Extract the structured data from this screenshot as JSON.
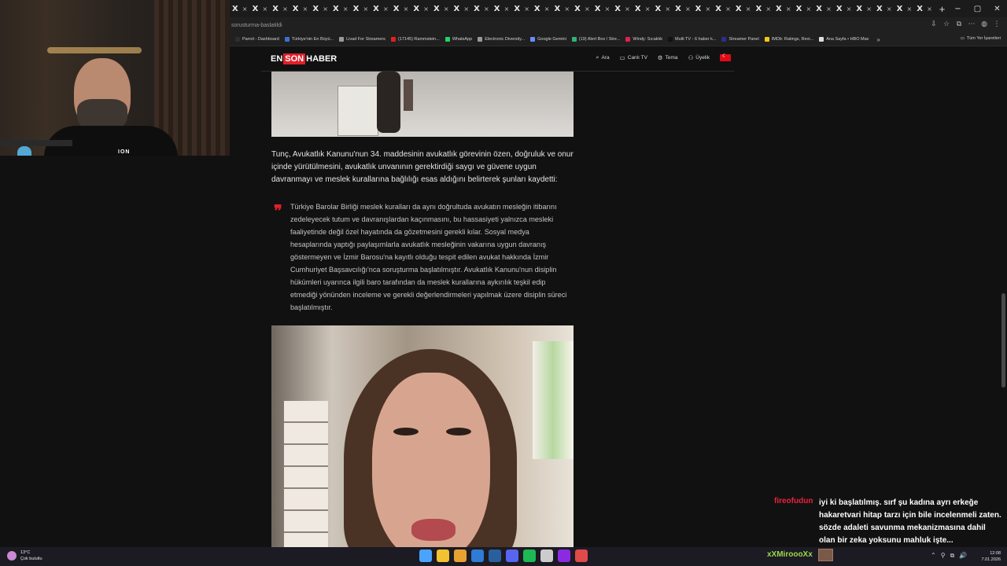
{
  "browser": {
    "tab_count": 35,
    "tab_logo": "X",
    "tab_close": "×",
    "new_tab": "+",
    "url": "sorusturma-baslatildi",
    "window_controls": [
      "−",
      "▢",
      "✕"
    ],
    "address_icons": [
      "⇩",
      "☆",
      "⧉",
      "⋯",
      "◍",
      "⋮"
    ]
  },
  "bookmarks": {
    "items": [
      {
        "label": "Parrot - Dashboard",
        "color": "#2e2e2e"
      },
      {
        "label": "Türkiye'nin En Büyü...",
        "color": "#3d6fd1"
      },
      {
        "label": "Livad For Streamers",
        "color": "#9a9a9a"
      },
      {
        "label": "(17145) Rammstein...",
        "color": "#e02020"
      },
      {
        "label": "WhatsApp",
        "color": "#25d366"
      },
      {
        "label": "Electronic Diversity...",
        "color": "#9a9a9a"
      },
      {
        "label": "Google Gemini",
        "color": "#6a8cff"
      },
      {
        "label": "(19) Alert Box / Stre...",
        "color": "#2bb673"
      },
      {
        "label": "Windy: Sıcaklık",
        "color": "#e02050"
      },
      {
        "label": "Multi TV - 6 haber k...",
        "color": "#111111"
      },
      {
        "label": "Streamer Panel",
        "color": "#2d2d8a"
      },
      {
        "label": "IMDb: Ratings, Revi...",
        "color": "#f5c518"
      },
      {
        "label": "Ana Sayfa • HBO Max",
        "color": "#dddddd"
      }
    ],
    "more": "»",
    "all_bookmarks": "Tüm Yer İşaretleri"
  },
  "webcam": {
    "shirt_logo": "ION"
  },
  "site": {
    "logo_en": "EN",
    "logo_son": "SON",
    "logo_haber": "HABER",
    "nav": [
      {
        "icon": "⌕",
        "label": "Ara"
      },
      {
        "icon": "▭",
        "label": "Canlı TV"
      },
      {
        "icon": "⚙",
        "label": "Tema"
      },
      {
        "icon": "⚇",
        "label": "Üyelik"
      }
    ]
  },
  "article": {
    "paragraph": "Tunç, Avukatlık Kanunu'nun 34. maddesinin avukatlık görevinin özen, doğruluk ve onur içinde yürütülmesini, avukatlık unvanının gerektirdiği saygı ve güvene uygun davranmayı ve meslek kurallarına bağlılığı esas aldığını belirterek şunları kaydetti:",
    "quote_mark": "❞",
    "quote": "Türkiye Barolar Birliği meslek kuralları da aynı doğrultuda avukatın mesleğin itibarını zedeleyecek tutum ve davranışlardan kaçınmasını, bu hassasiyeti yalnızca mesleki faaliyetinde değil özel hayatında da gözetmesini gerekli kılar. Sosyal medya hesaplarında yaptığı paylaşımlarla avukatlık mesleğinin vakarına uygun davranış göstermeyen ve İzmir Barosu'na kayıtlı olduğu tespit edilen avukat hakkında İzmir Cumhuriyet Başsavcılığı'nca soruşturma başlatılmıştır. Avukatlık Kanunu'nun disiplin hükümleri uyarınca ilgili baro tarafından da meslek kurallarına aykırılık teşkil edip etmediği yönünden inceleme ve gerekli değerlendirmeleri yapılmak üzere disiplin süreci başlatılmıştır."
  },
  "chat": {
    "username": "fireofudun",
    "message": "iyi ki başlatılmış. sırf şu kadına ayrı erkeğe hakaretvari hitap tarzı için bile incelenmeli zaten. sözde adaleti savunma mekanizmasına dahil olan bir zeka yoksunu mahluk işte..."
  },
  "taskbar": {
    "temperature": "13°C",
    "weather": "Çok bulutlu",
    "app_colors": [
      "#4aa3ff",
      "#f2c230",
      "#e8a030",
      "#2f7bd6",
      "#2a5f9e",
      "#5865f2",
      "#1db954",
      "#cccccc",
      "#8a2be2",
      "#e04a4a"
    ],
    "streamer_name": "xXMiroooXx",
    "tray": [
      "⌃",
      "⚲",
      "⧉",
      "🔊"
    ],
    "time": "12:08",
    "date": "7.01.2026"
  }
}
